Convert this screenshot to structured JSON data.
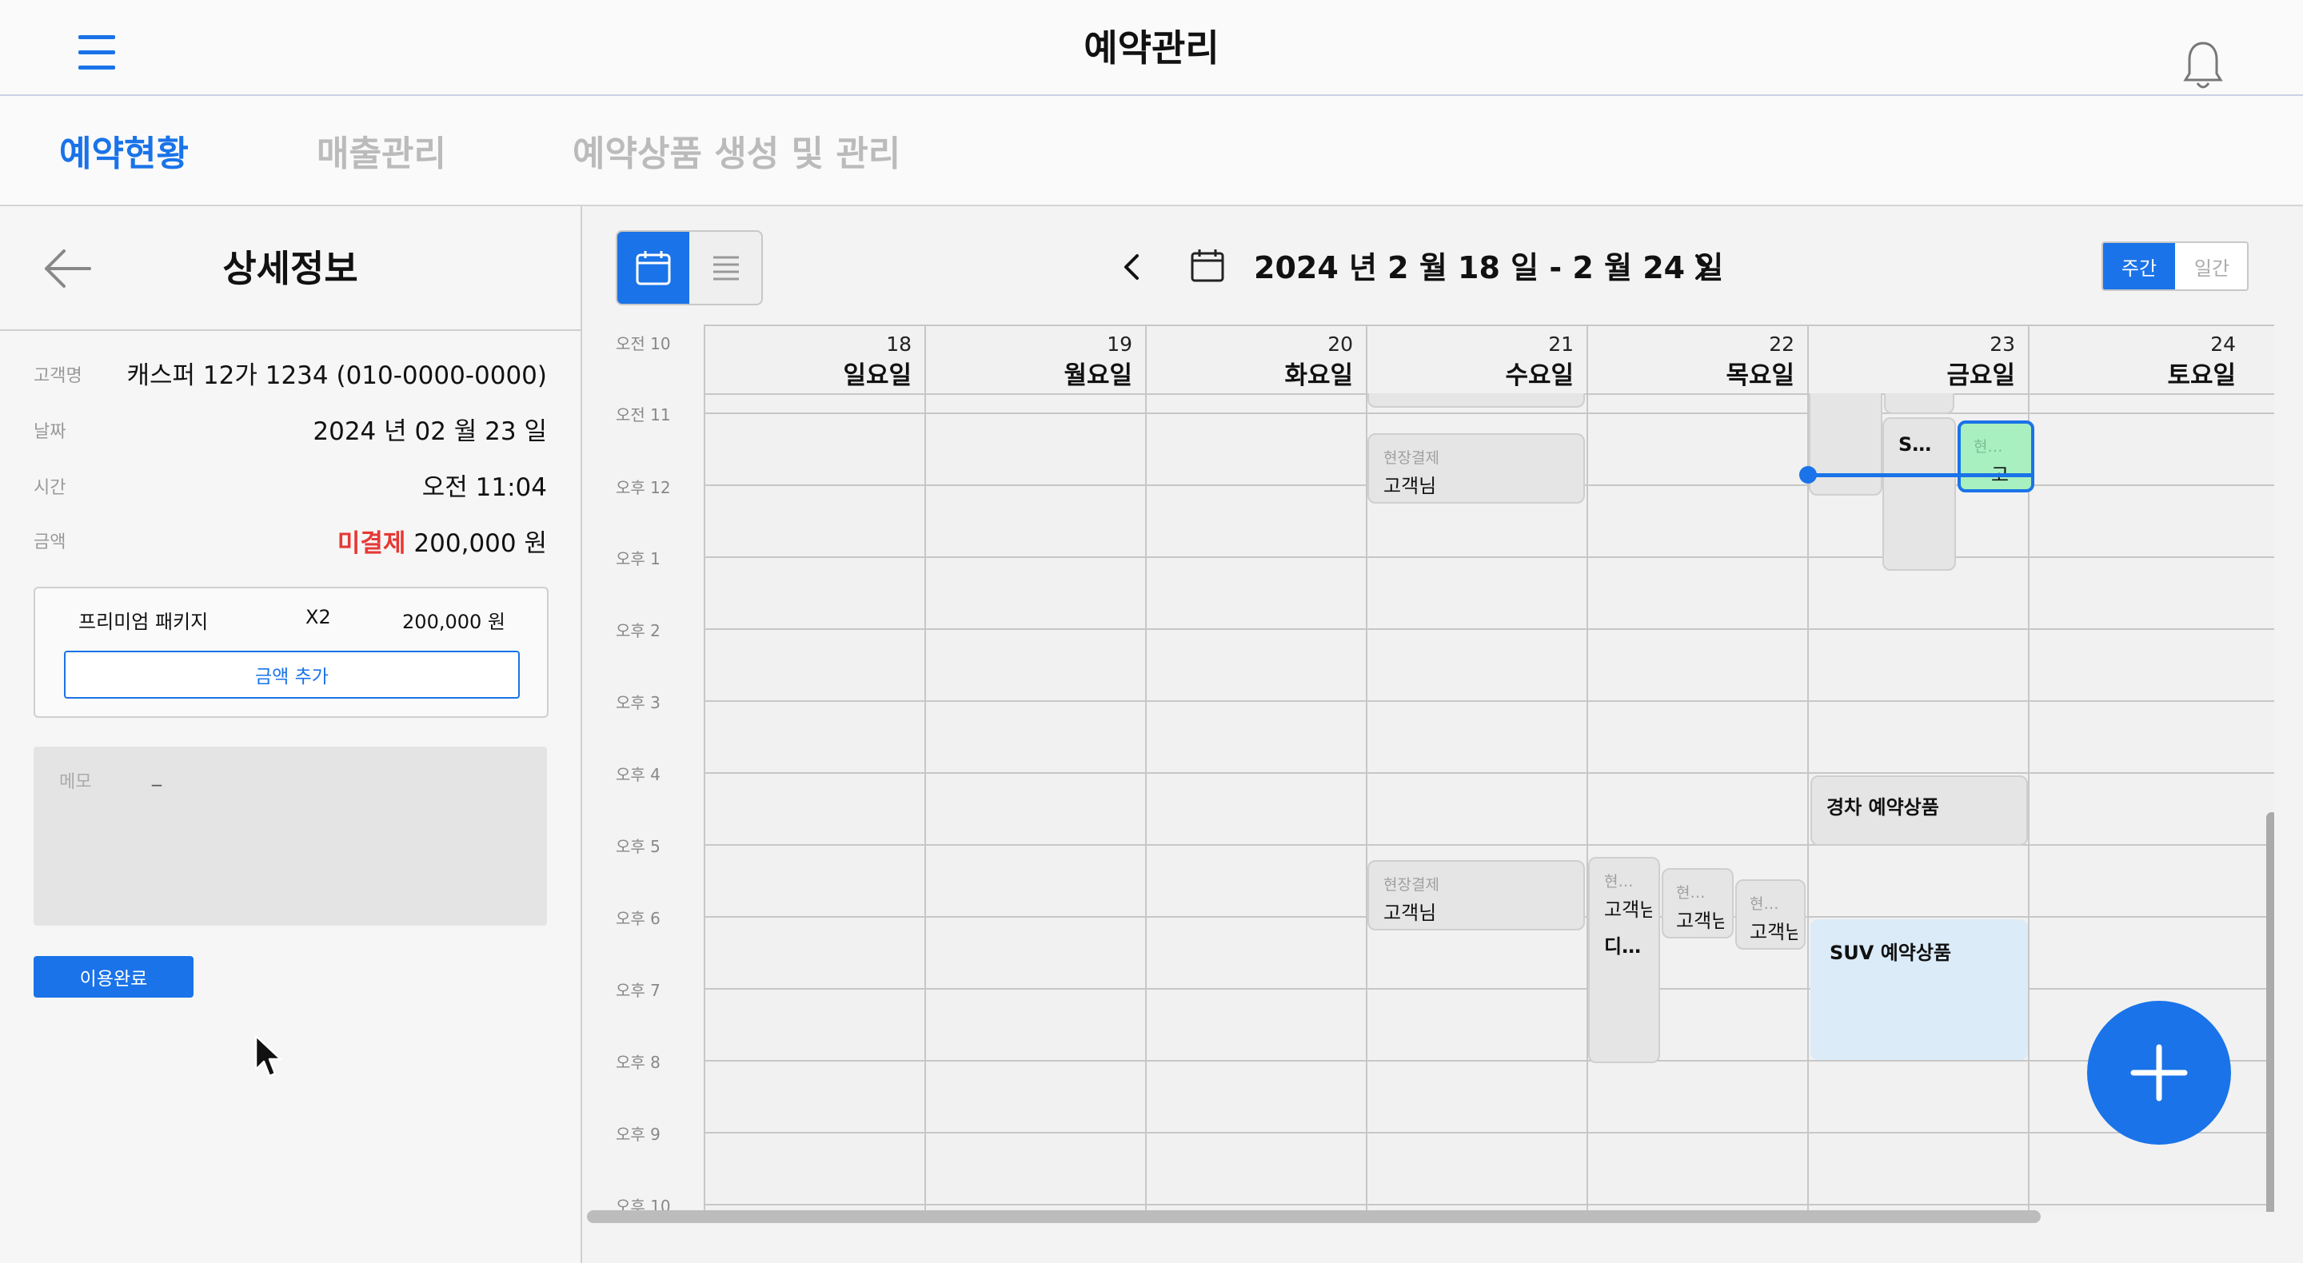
{
  "header": {
    "title": "예약관리"
  },
  "nav": {
    "tabs": [
      {
        "label": "예약현황",
        "active": true
      },
      {
        "label": "매출관리",
        "active": false
      },
      {
        "label": "예약상품 생성 및 관리",
        "active": false
      }
    ]
  },
  "detail": {
    "title": "상세정보",
    "fields": {
      "customer_label": "고객명",
      "customer_value": "캐스퍼 12가 1234 (010-0000-0000)",
      "date_label": "날짜",
      "date_value": "2024 년 02 월 23 일",
      "time_label": "시간",
      "time_value": "오전 11:04",
      "amount_label": "금액",
      "amount_status": "미결제",
      "amount_value": "200,000 원"
    },
    "item": {
      "name": "프리미엄 패키지",
      "qty": "X2",
      "price": "200,000 원"
    },
    "add_amount_button": "금액 추가",
    "memo_label": "메모",
    "memo_value": "_",
    "complete_button": "이용완료"
  },
  "calendar": {
    "date_range": "2024 년  2 월  18 일 - 2 월  24 일",
    "mode_week": "주간",
    "mode_day": "일간",
    "times": [
      "오전 10",
      "오전 11",
      "오후 12",
      "오후 1",
      "오후 2",
      "오후 3",
      "오후 4",
      "오후 5",
      "오후 6",
      "오후 7",
      "오후 8",
      "오후 9",
      "오후 10"
    ],
    "days": [
      {
        "num": "18",
        "name": "일요일"
      },
      {
        "num": "19",
        "name": "월요일"
      },
      {
        "num": "20",
        "name": "화요일"
      },
      {
        "num": "21",
        "name": "수요일"
      },
      {
        "num": "22",
        "name": "목요일"
      },
      {
        "num": "23",
        "name": "금요일"
      },
      {
        "num": "24",
        "name": "토요일"
      }
    ],
    "events": {
      "wed_am_sub": "현장결제",
      "wed_am_main": "고객님",
      "wed_pm_sub": "현장결제",
      "wed_pm_main": "고객님",
      "fri_s": "S…",
      "fri_green_sub": "현…",
      "fri_green_main": "고",
      "fri_compact": "경차 예약상품",
      "fri_suv": "SUV 예약상품",
      "thu1_sub": "현…",
      "thu1_main": "고객님",
      "thu1_extra": "디…",
      "thu2_sub": "현…",
      "thu2_main": "고객님",
      "thu3_sub": "현…",
      "thu3_main": "고객님"
    }
  },
  "icons": [
    "menu-icon",
    "bell-icon",
    "back-arrow-icon",
    "calendar-icon",
    "list-icon",
    "chevron-left-icon",
    "chevron-right-icon",
    "plus-icon",
    "mouse-cursor-icon"
  ],
  "colors": {
    "accent": "#1a73e8",
    "unpaid": "#e53935",
    "selected_event": "#a8f0c0",
    "suv_event": "#dcebf8"
  }
}
